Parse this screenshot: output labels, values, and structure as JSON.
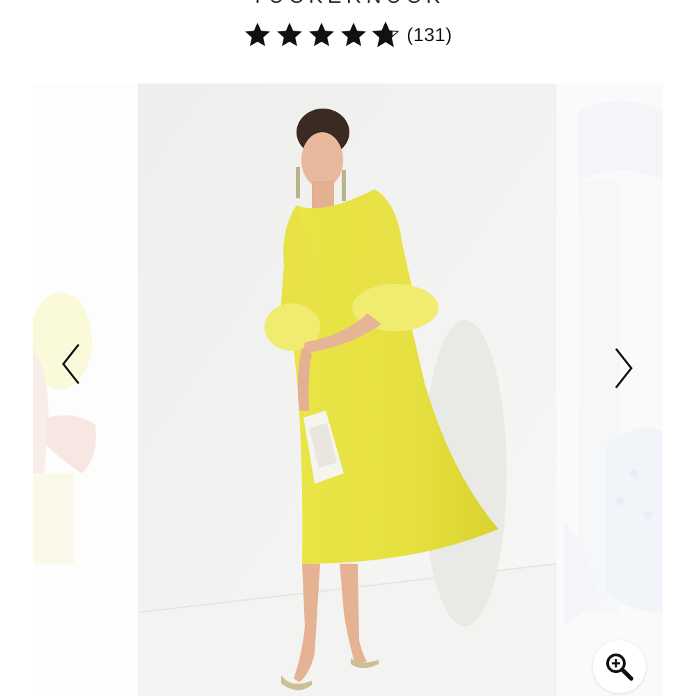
{
  "product": {
    "brand": "TUCKERNUCK"
  },
  "reviews": {
    "rating": 4.5,
    "max_rating": 5,
    "count_text": "(131)"
  },
  "gallery": {
    "main_image": "yellow-feather-dress-photo",
    "prev_image": "previous-product-photo",
    "next_image": "next-product-photo",
    "prev_icon": "chevron-left-icon",
    "next_icon": "chevron-right-icon",
    "zoom_icon": "zoom-in-icon"
  },
  "colors": {
    "star": "#111111",
    "dress": "#e9e34a",
    "background": "#ffffff"
  }
}
